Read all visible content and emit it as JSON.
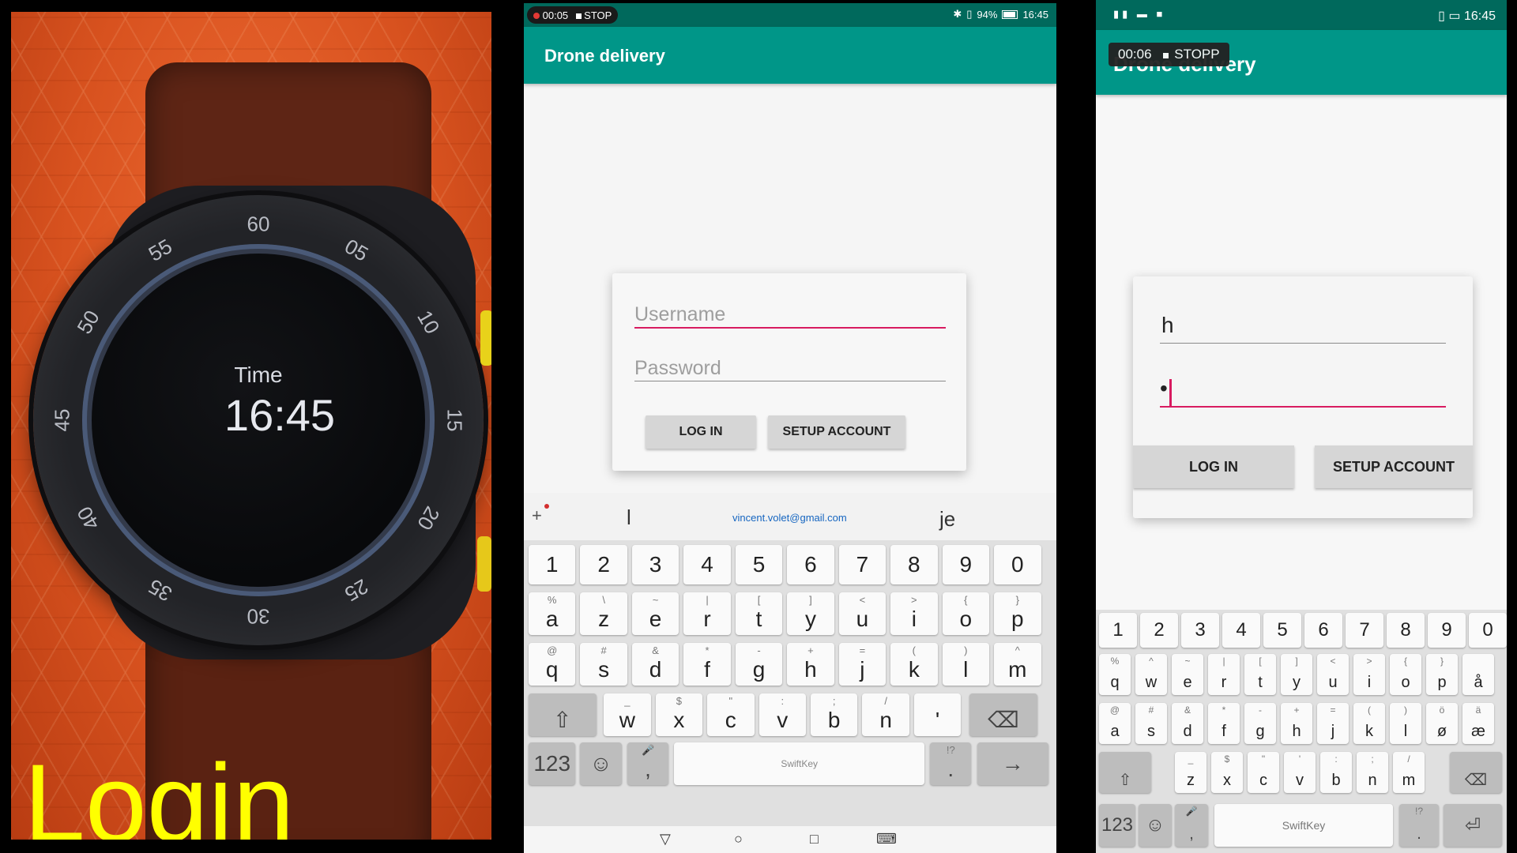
{
  "panel1": {
    "watch": {
      "ticks": [
        "60",
        "05",
        "10",
        "15",
        "20",
        "25",
        "30",
        "35",
        "40",
        "45",
        "50",
        "55"
      ],
      "label": "Time",
      "time": "16:45"
    },
    "caption": "Login"
  },
  "panel2": {
    "status": {
      "rec_time": "00:05",
      "stop": "STOP",
      "battery": "94%",
      "clock": "16:45"
    },
    "appbar_title": "Drone delivery",
    "dialog": {
      "username_placeholder": "Username",
      "password_placeholder": "Password",
      "login_label": "LOG IN",
      "setup_label": "SETUP ACCOUNT"
    },
    "suggestions": [
      "l",
      "vincent.volet@gmail.com",
      "je"
    ],
    "keyboard": {
      "row_numbers": [
        "1",
        "2",
        "3",
        "4",
        "5",
        "6",
        "7",
        "8",
        "9",
        "0"
      ],
      "row1": [
        [
          "a",
          "%"
        ],
        [
          "z",
          "\\"
        ],
        [
          "e",
          "~"
        ],
        [
          "r",
          "|"
        ],
        [
          "t",
          "["
        ],
        [
          "y",
          "]"
        ],
        [
          "u",
          "<"
        ],
        [
          "i",
          ">"
        ],
        [
          "o",
          "{"
        ],
        [
          "p",
          "}"
        ]
      ],
      "row2": [
        [
          "q",
          "@"
        ],
        [
          "s",
          "#"
        ],
        [
          "d",
          "&"
        ],
        [
          "f",
          "*"
        ],
        [
          "g",
          "-"
        ],
        [
          "h",
          "+"
        ],
        [
          "j",
          "="
        ],
        [
          "k",
          "("
        ],
        [
          "l",
          ")"
        ],
        [
          "m",
          "^"
        ]
      ],
      "row3": [
        [
          "w",
          "_"
        ],
        [
          "x",
          "$"
        ],
        [
          "c",
          "\""
        ],
        [
          "v",
          ":"
        ],
        [
          "b",
          ";"
        ],
        [
          "n",
          "/"
        ],
        [
          "'",
          ""
        ]
      ],
      "symbols_label": "123",
      "space_label": "SwiftKey"
    }
  },
  "panel3": {
    "status": {
      "clock": "16:45"
    },
    "recording": {
      "time": "00:06",
      "stop": "STOPP"
    },
    "appbar_title": "Drone delivery",
    "dialog": {
      "username_value": "h",
      "password_value": "•",
      "login_label": "LOG IN",
      "setup_label": "SETUP ACCOUNT"
    },
    "keyboard": {
      "row_numbers": [
        "1",
        "2",
        "3",
        "4",
        "5",
        "6",
        "7",
        "8",
        "9",
        "0"
      ],
      "row1": [
        [
          "q",
          "%"
        ],
        [
          "w",
          "^"
        ],
        [
          "e",
          "~"
        ],
        [
          "r",
          "|"
        ],
        [
          "t",
          "["
        ],
        [
          "y",
          "]"
        ],
        [
          "u",
          "<"
        ],
        [
          "i",
          ">"
        ],
        [
          "o",
          "{"
        ],
        [
          "p",
          "}"
        ],
        [
          "å",
          ""
        ]
      ],
      "row2": [
        [
          "a",
          "@"
        ],
        [
          "s",
          "#"
        ],
        [
          "d",
          "&"
        ],
        [
          "f",
          "*"
        ],
        [
          "g",
          "-"
        ],
        [
          "h",
          "+"
        ],
        [
          "j",
          "="
        ],
        [
          "k",
          "("
        ],
        [
          "l",
          ")"
        ],
        [
          "ø",
          "ö"
        ],
        [
          "æ",
          "ä"
        ]
      ],
      "row3": [
        [
          "z",
          "_"
        ],
        [
          "x",
          "$"
        ],
        [
          "c",
          "\""
        ],
        [
          "v",
          "'"
        ],
        [
          "b",
          ":"
        ],
        [
          "n",
          ";"
        ],
        [
          "m",
          "/"
        ]
      ],
      "symbols_label": "123",
      "space_label": "SwiftKey"
    }
  }
}
